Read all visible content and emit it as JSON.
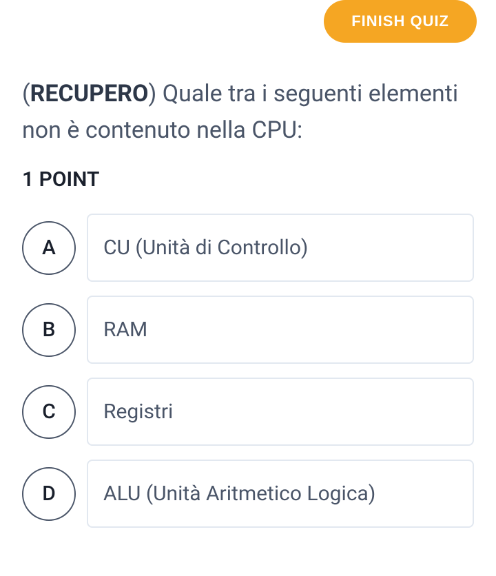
{
  "finish_button_label": "FINISH QUIZ",
  "question": {
    "prefix_open": "(",
    "prefix_bold": "RECUPERO",
    "prefix_close": ")",
    "text": " Quale tra i seguenti elementi non è contenuto nella CPU:"
  },
  "points_label": "1 POINT",
  "options": [
    {
      "letter": "A",
      "text": "CU (Unità di Controllo)"
    },
    {
      "letter": "B",
      "text": "RAM"
    },
    {
      "letter": "C",
      "text": "Registri"
    },
    {
      "letter": "D",
      "text": "ALU (Unità Aritmetico Logica)"
    }
  ]
}
